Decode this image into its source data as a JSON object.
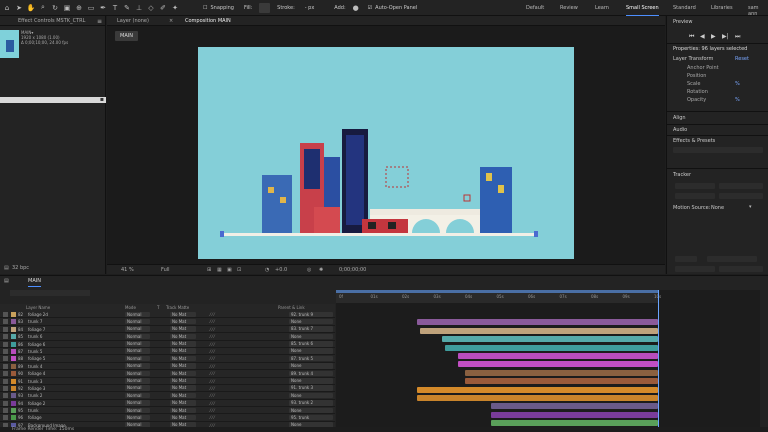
{
  "toolbar": {
    "snapping": "Snapping",
    "fill_label": "Fill:",
    "stroke_label": "Stroke:",
    "stroke_value": "- px",
    "add_label": "Add:",
    "auto_open": "Auto-Open Panel",
    "workspaces": [
      "Default",
      "Review",
      "Learn",
      "Small Screen",
      "Standard",
      "Libraries",
      "sam ann"
    ],
    "active_workspace": "Small Screen"
  },
  "project": {
    "tab": "Effect Controls MSTK_CTRL",
    "comp_name": "MAIN▾",
    "comp_size": "1920 x 1080 (1.00)",
    "comp_duration": "Δ 0;00;10;00, 24.00 fps",
    "bpc": "32 bpc"
  },
  "viewer": {
    "layer_tab": "Layer (none)",
    "comp_tab": "Composition MAIN",
    "chip": "MAIN",
    "zoom": "41 %",
    "quality": "Full",
    "exposure": "+0.0",
    "timecode": "0;00;00;00"
  },
  "right": {
    "preview": "Preview",
    "properties": "Properties: 96 layers selected",
    "layer_transform": "Layer Transform",
    "reset": "Reset",
    "props": [
      "Anchor Point",
      "Position",
      "Scale",
      "Rotation",
      "Opacity"
    ],
    "scale_val": "%",
    "opacity_val": "%",
    "align": "Align",
    "audio": "Audio",
    "effects": "Effects & Presets",
    "tracker": "Tracker",
    "motion_source": "Motion Source:",
    "motion_source_value": "None"
  },
  "timeline": {
    "tab": "MAIN",
    "headers": {
      "name": "Layer Name",
      "mode": "Mode",
      "t": "T",
      "trkmat": "Track Matte",
      "parent": "Parent & Link"
    },
    "ticks": [
      "0f",
      "01s",
      "02s",
      "03s",
      "04s",
      "05s",
      "06s",
      "07s",
      "08s",
      "09s",
      "10s"
    ],
    "footer": "Frame Render Time: 150ms",
    "layers": [
      {
        "num": "82",
        "name": "foliage 2d",
        "mode": "Normal",
        "tm": "No Mat",
        "parent": "92. trunk 9",
        "color": "#c9a15c"
      },
      {
        "num": "83",
        "name": "trunk 7",
        "mode": "Normal",
        "tm": "No Mat",
        "parent": "None",
        "color": "#8a5a9a"
      },
      {
        "num": "84",
        "name": "foliage 7",
        "mode": "Normal",
        "tm": "No Mat",
        "parent": "83. trunk 7",
        "color": "#bfa27b"
      },
      {
        "num": "85",
        "name": "trunk 6",
        "mode": "Normal",
        "tm": "No Mat",
        "parent": "None",
        "color": "#56a9a9"
      },
      {
        "num": "86",
        "name": "foliage 6",
        "mode": "Normal",
        "tm": "No Mat",
        "parent": "85. trunk 6",
        "color": "#3f9c9c"
      },
      {
        "num": "87",
        "name": "trunk 5",
        "mode": "Normal",
        "tm": "No Mat",
        "parent": "None",
        "color": "#b84dbd"
      },
      {
        "num": "88",
        "name": "foliage 5",
        "mode": "Normal",
        "tm": "No Mat",
        "parent": "87. trunk 5",
        "color": "#c24fc4"
      },
      {
        "num": "89",
        "name": "trunk 4",
        "mode": "Normal",
        "tm": "No Mat",
        "parent": "None",
        "color": "#8a6040"
      },
      {
        "num": "90",
        "name": "foliage 4",
        "mode": "Normal",
        "tm": "No Mat",
        "parent": "89. trunk 4",
        "color": "#9a5a3a"
      },
      {
        "num": "91",
        "name": "trunk 3",
        "mode": "Normal",
        "tm": "No Mat",
        "parent": "None",
        "color": "#d48a2a"
      },
      {
        "num": "92",
        "name": "foliage 3",
        "mode": "Normal",
        "tm": "No Mat",
        "parent": "91. trunk 3",
        "color": "#c9842b"
      },
      {
        "num": "93",
        "name": "trunk 2",
        "mode": "Normal",
        "tm": "No Mat",
        "parent": "None",
        "color": "#6a5a8a"
      },
      {
        "num": "94",
        "name": "foliage 2",
        "mode": "Normal",
        "tm": "No Mat",
        "parent": "93. trunk 2",
        "color": "#7a3c9a"
      },
      {
        "num": "95",
        "name": "trunk",
        "mode": "Normal",
        "tm": "No Mat",
        "parent": "None",
        "color": "#5aa05a"
      },
      {
        "num": "96",
        "name": "foliage",
        "mode": "Normal",
        "tm": "No Mat",
        "parent": "95. trunk",
        "color": "#4a9a4a"
      },
      {
        "num": "97",
        "name": "Background Image",
        "mode": "Normal",
        "tm": "No Mat",
        "parent": "None",
        "color": "#5a5aa0"
      }
    ]
  }
}
